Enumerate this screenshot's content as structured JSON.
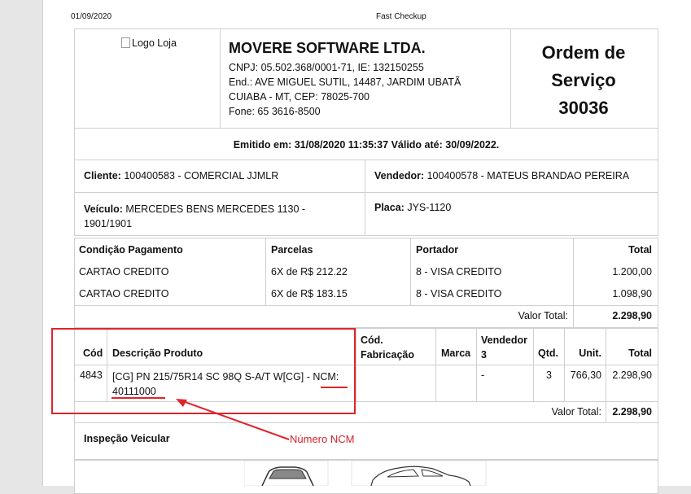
{
  "print_header": {
    "date": "01/09/2020",
    "title": "Fast Checkup"
  },
  "company": {
    "logo_alt": "Logo Loja",
    "name": "MOVERE SOFTWARE LTDA.",
    "cnpj_ie": "CNPJ: 05.502.368/0001-71, IE: 132150255",
    "address": "End.: AVE MIGUEL SUTIL, 14487, JARDIM UBATÃ",
    "city": "CUIABA - MT, CEP: 78025-700",
    "phone": "Fone: 65 3616-8500"
  },
  "order": {
    "title_line1": "Ordem de",
    "title_line2": "Serviço",
    "number": "30036"
  },
  "emission": "Emitido em: 31/08/2020 11:35:37 Válido até: 30/09/2022.",
  "client": {
    "label": "Cliente:",
    "value": "100400583 - COMERCIAL JJMLR"
  },
  "seller": {
    "label": "Vendedor:",
    "value": "100400578 - MATEUS BRANDAO PEREIRA"
  },
  "vehicle": {
    "label": "Veículo:",
    "value_line1": "MERCEDES BENS MERCEDES 1130 -",
    "value_line2": "1901/1901"
  },
  "plate": {
    "label": "Placa:",
    "value": "JYS-1120"
  },
  "payment": {
    "headers": {
      "condition": "Condição Pagamento",
      "installments": "Parcelas",
      "carrier": "Portador",
      "total": "Total"
    },
    "rows": [
      {
        "condition": "CARTAO CREDITO",
        "installments": "6X de R$ 212.22",
        "carrier": "8 - VISA CREDITO",
        "total": "1.200,00"
      },
      {
        "condition": "CARTAO CREDITO",
        "installments": "6X de R$ 183.15",
        "carrier": "8 - VISA CREDITO",
        "total": "1.098,90"
      }
    ],
    "total_label": "Valor Total:",
    "total_value": "2.298,90"
  },
  "products": {
    "headers": {
      "code": "Cód",
      "description": "Descrição Produto",
      "mfg_code_1": "Cód.",
      "mfg_code_2": "Fabricação",
      "brand": "Marca",
      "seller_1": "Vendedor",
      "seller_2": "3",
      "qty": "Qtd.",
      "unit": "Unit.",
      "total": "Total"
    },
    "rows": [
      {
        "code": "4843",
        "description_line1_a": "[CG] PN 215/75R14 SC 98Q S-A/T W[CG] - ",
        "description_line1_b": "NCM:",
        "description_line2": "40111000",
        "mfg_code": "",
        "brand": "",
        "seller": "-",
        "qty": "3",
        "unit": "766,30",
        "total": "2.298,90"
      }
    ],
    "total_label": "Valor Total:",
    "total_value": "2.298,90"
  },
  "inspection": {
    "title": "Inspeção Veicular"
  },
  "annotation": {
    "label": "Número NCM",
    "color": "#e0242b"
  }
}
